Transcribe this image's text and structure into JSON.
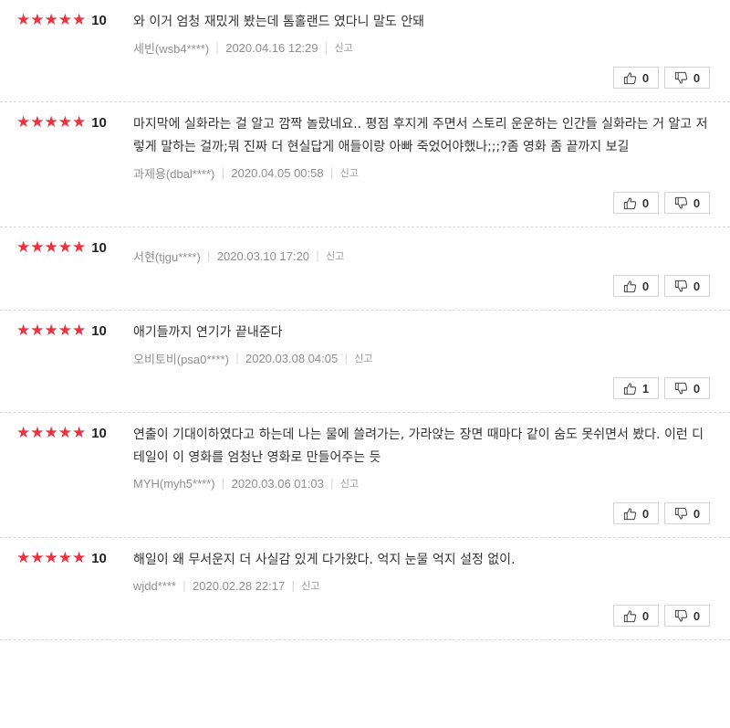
{
  "reviews": [
    {
      "stars": "★★★★★",
      "score": "10",
      "text": "와 이거 엄청 재밌게 봤는데 톰홀랜드 였다니 말도 안돼",
      "nick": "세빈(wsb4****)",
      "date": "2020.04.16 12:29",
      "report": "신고",
      "like": "0",
      "dislike": "0"
    },
    {
      "stars": "★★★★★",
      "score": "10",
      "text": "마지막에 실화라는 걸 알고 깜짝 놀랐네요.. 평점 후지게 주면서 스토리 운운하는 인간들 실화라는 거 알고 저렇게 말하는 걸까;뭐 진짜 더 현실답게 애들이랑 아빠 죽었어야했나;;;?좀 영화 좀 끝까지 보길",
      "nick": "과제용(dbal****)",
      "date": "2020.04.05 00:58",
      "report": "신고",
      "like": "0",
      "dislike": "0"
    },
    {
      "stars": "★★★★★",
      "score": "10",
      "text": "",
      "nick": "서현(tjgu****)",
      "date": "2020.03.10 17:20",
      "report": "신고",
      "like": "0",
      "dislike": "0"
    },
    {
      "stars": "★★★★★",
      "score": "10",
      "text": "애기들까지 연기가 끝내준다",
      "nick": "오비토비(psa0****)",
      "date": "2020.03.08 04:05",
      "report": "신고",
      "like": "1",
      "dislike": "0"
    },
    {
      "stars": "★★★★★",
      "score": "10",
      "text": "연출이 기대이하였다고 하는데 나는 물에 쓸려가는, 가라앉는 장면 때마다 같이 숨도 못쉬면서 봤다. 이런 디테일이 이 영화를 엄청난 영화로 만들어주는 듯",
      "nick": "MYH(myh5****)",
      "date": "2020.03.06 01:03",
      "report": "신고",
      "like": "0",
      "dislike": "0"
    },
    {
      "stars": "★★★★★",
      "score": "10",
      "text": "해일이 왜 무서운지 더 사실감 있게 다가왔다. 억지 눈물 억지 설정 없이.",
      "nick": "wjdd****",
      "date": "2020.02.28 22:17",
      "report": "신고",
      "like": "0",
      "dislike": "0"
    }
  ],
  "colors": {
    "star": "#f0303e",
    "meta": "#999999",
    "border": "#d3d3d3"
  },
  "icons": {
    "like": "thumbs-up-icon",
    "dislike": "thumbs-down-icon"
  }
}
